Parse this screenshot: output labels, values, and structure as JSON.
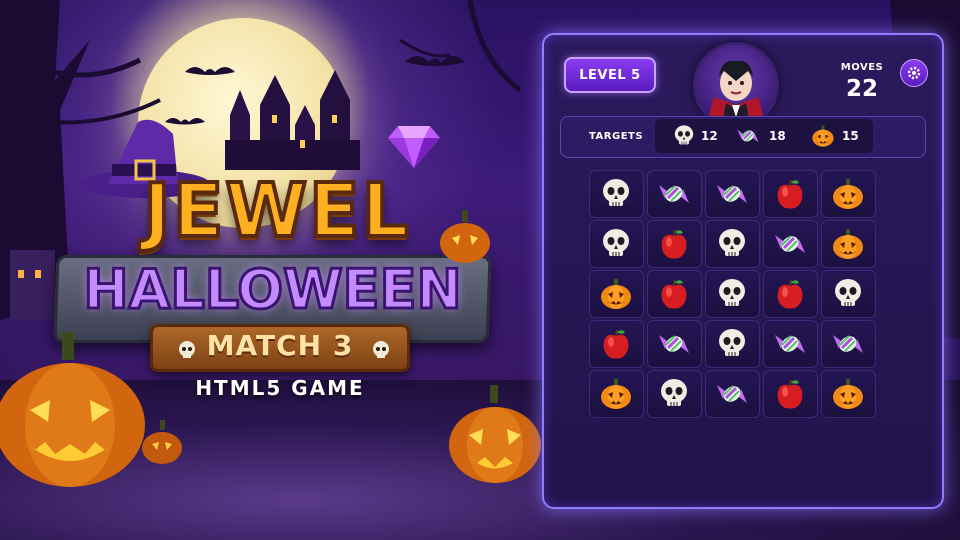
{
  "logo": {
    "title_line1": "JEWEL",
    "title_line2": "HALLOWEEN",
    "ribbon_text": "MATCH 3",
    "subtitle": "HTML5 GAME"
  },
  "hud": {
    "level_label": "LEVEL 5",
    "moves_label": "MOVES",
    "moves_value": "22",
    "settings_icon": "gear-icon",
    "avatar_icon": "vampire-avatar-icon"
  },
  "targets": {
    "label": "TARGETS",
    "items": [
      {
        "icon": "skull",
        "count": "12"
      },
      {
        "icon": "candy",
        "count": "18"
      },
      {
        "icon": "pumpkin",
        "count": "15"
      }
    ]
  },
  "board": {
    "rows": [
      [
        "skull",
        "candy",
        "candy",
        "apple",
        "pumpkin"
      ],
      [
        "skull",
        "apple",
        "skull",
        "candy",
        "pumpkin"
      ],
      [
        "pumpkin",
        "apple",
        "skull",
        "apple",
        "skull"
      ],
      [
        "apple",
        "candy",
        "skull",
        "candy",
        "candy"
      ],
      [
        "pumpkin",
        "skull",
        "candy",
        "apple",
        "pumpkin"
      ]
    ]
  },
  "colors": {
    "panel_border": "#8f7dff",
    "level_button": "#7a2ee0",
    "jewel_title": "#ffb020",
    "halloween_title": "#c48bff"
  }
}
